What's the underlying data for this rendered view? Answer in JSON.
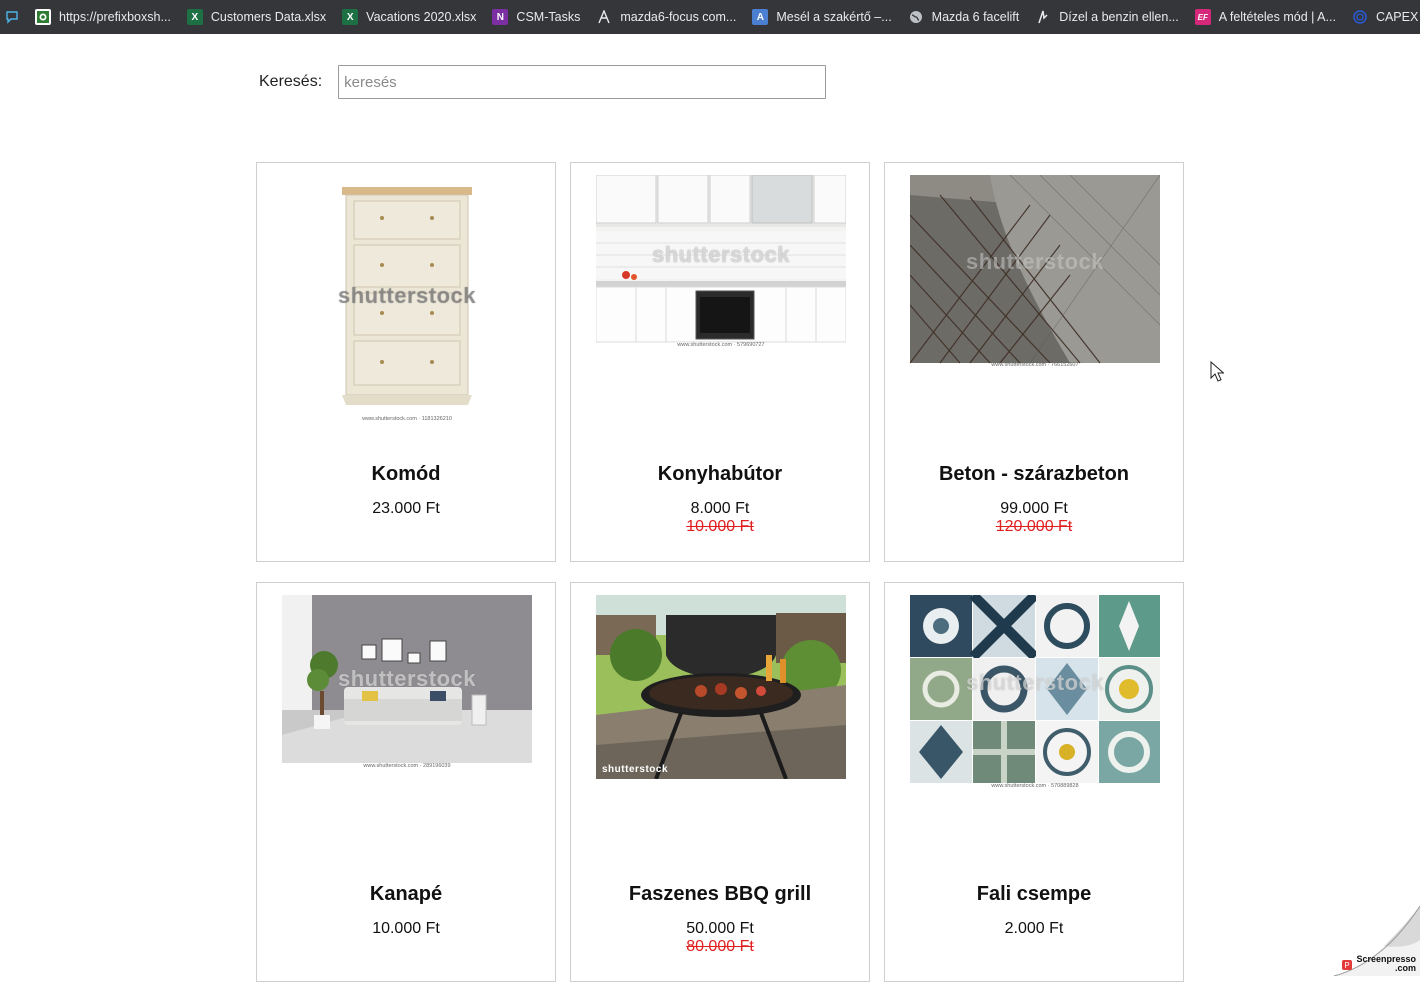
{
  "bookmarks": [
    {
      "label": "https://prefixboxsh...",
      "icon": "prefixbox-icon",
      "color": "#ffffff"
    },
    {
      "label": "Customers Data.xlsx",
      "icon": "excel-icon",
      "color": "#1d7044"
    },
    {
      "label": "Vacations 2020.xlsx",
      "icon": "excel-icon",
      "color": "#1d7044"
    },
    {
      "label": "CSM-Tasks",
      "icon": "onenote-icon",
      "color": "#7b2fa3"
    },
    {
      "label": "mazda6-focus com...",
      "icon": "mazda-forum-icon",
      "color": "#35363a"
    },
    {
      "label": "Mesél a szakértő –...",
      "icon": "article-icon",
      "color": "#4a7fd1"
    },
    {
      "label": "Mazda 6 facelift",
      "icon": "globe-icon",
      "color": "#35363a"
    },
    {
      "label": "Dízel a benzin ellen...",
      "icon": "news-icon",
      "color": "#35363a"
    },
    {
      "label": "A feltételes mód | A...",
      "icon": "ef-icon",
      "color": "#d6287a"
    },
    {
      "label": "CAPEX és OPEX",
      "icon": "capex-icon",
      "color": "#2a5bd7"
    }
  ],
  "search": {
    "label": "Keresés:",
    "placeholder": "keresés"
  },
  "watermark": "shutterstock",
  "products": [
    {
      "name": "Komód",
      "price": "23.000 Ft",
      "old_price": "",
      "image": "dresser",
      "caption": "www.shutterstock.com · 1181326210"
    },
    {
      "name": "Konyhabútor",
      "price": "8.000 Ft",
      "old_price": "10.000 Ft",
      "image": "kitchen",
      "caption": "www.shutterstock.com · 579690727"
    },
    {
      "name": "Beton - szárazbeton",
      "price": "99.000 Ft",
      "old_price": "120.000 Ft",
      "image": "concrete",
      "caption": "www.shutterstock.com · 766152607"
    },
    {
      "name": "Kanapé",
      "price": "10.000 Ft",
      "old_price": "",
      "image": "sofa-room",
      "caption": "www.shutterstock.com · 289196039"
    },
    {
      "name": "Faszenes BBQ grill",
      "price": "50.000 Ft",
      "old_price": "80.000 Ft",
      "image": "bbq-grill",
      "caption": ""
    },
    {
      "name": "Fali csempe",
      "price": "2.000 Ft",
      "old_price": "",
      "image": "tiles",
      "caption": "www.shutterstock.com · 570889828"
    }
  ],
  "badge": {
    "line1": "Screenpresso",
    "line2": ".com"
  }
}
